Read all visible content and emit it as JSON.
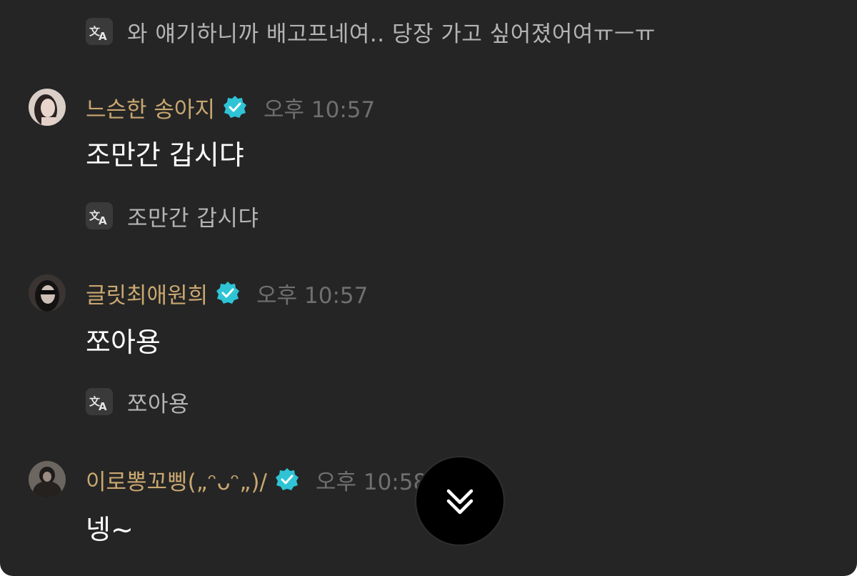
{
  "messages": [
    {
      "translation": "와 얘기하니까 배고프네여.. 당장 가고 싶어졌어여ㅠㅡㅠ"
    },
    {
      "username": "느슨한 송아지",
      "time": "오후 10:57",
      "text": "조만간 갑시댜",
      "translation": "조만간 갑시댜"
    },
    {
      "username": "글릿최애원희",
      "time": "오후 10:57",
      "text": "쪼아용",
      "translation": "쪼아용"
    },
    {
      "username": "이로뽕꼬삥(„ᵔᴗᵔ„)/",
      "time": "오후 10:58",
      "text": "넹~"
    }
  ],
  "colors": {
    "background": "#252525",
    "username": "#c9a770",
    "time": "#6f6f6f",
    "translation": "#b4b4b4",
    "verified": "#2ec4d6"
  },
  "icons": {
    "translate": "translate-icon",
    "verified": "verified-badge-icon",
    "scroll_down": "chevron-double-down-icon"
  }
}
